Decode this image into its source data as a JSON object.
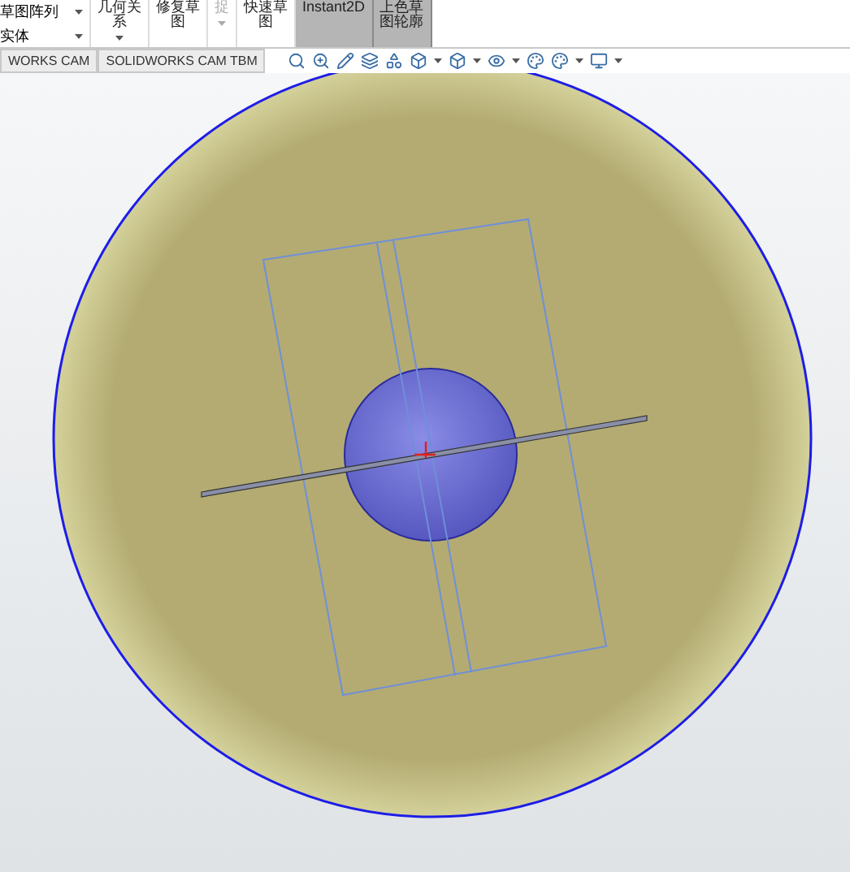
{
  "ribbon": {
    "left_rows": [
      {
        "label": "草图阵列"
      },
      {
        "label": "实体"
      }
    ],
    "buttons": [
      {
        "label": "几何关系",
        "selected": false,
        "disabled": false,
        "caret": true
      },
      {
        "label": "修复草图",
        "selected": false,
        "disabled": false,
        "caret": false
      },
      {
        "label": "捉",
        "selected": false,
        "disabled": true,
        "caret": true
      },
      {
        "label": "快速草图",
        "selected": false,
        "disabled": false,
        "caret": false
      },
      {
        "label": "Instant2D",
        "selected": true,
        "disabled": false,
        "caret": false
      },
      {
        "label": "上色草图轮廓",
        "selected": true,
        "disabled": false,
        "caret": false
      }
    ]
  },
  "tabs": [
    {
      "label": "WORKS CAM"
    },
    {
      "label": "SOLIDWORKS CAM TBM"
    }
  ]
}
